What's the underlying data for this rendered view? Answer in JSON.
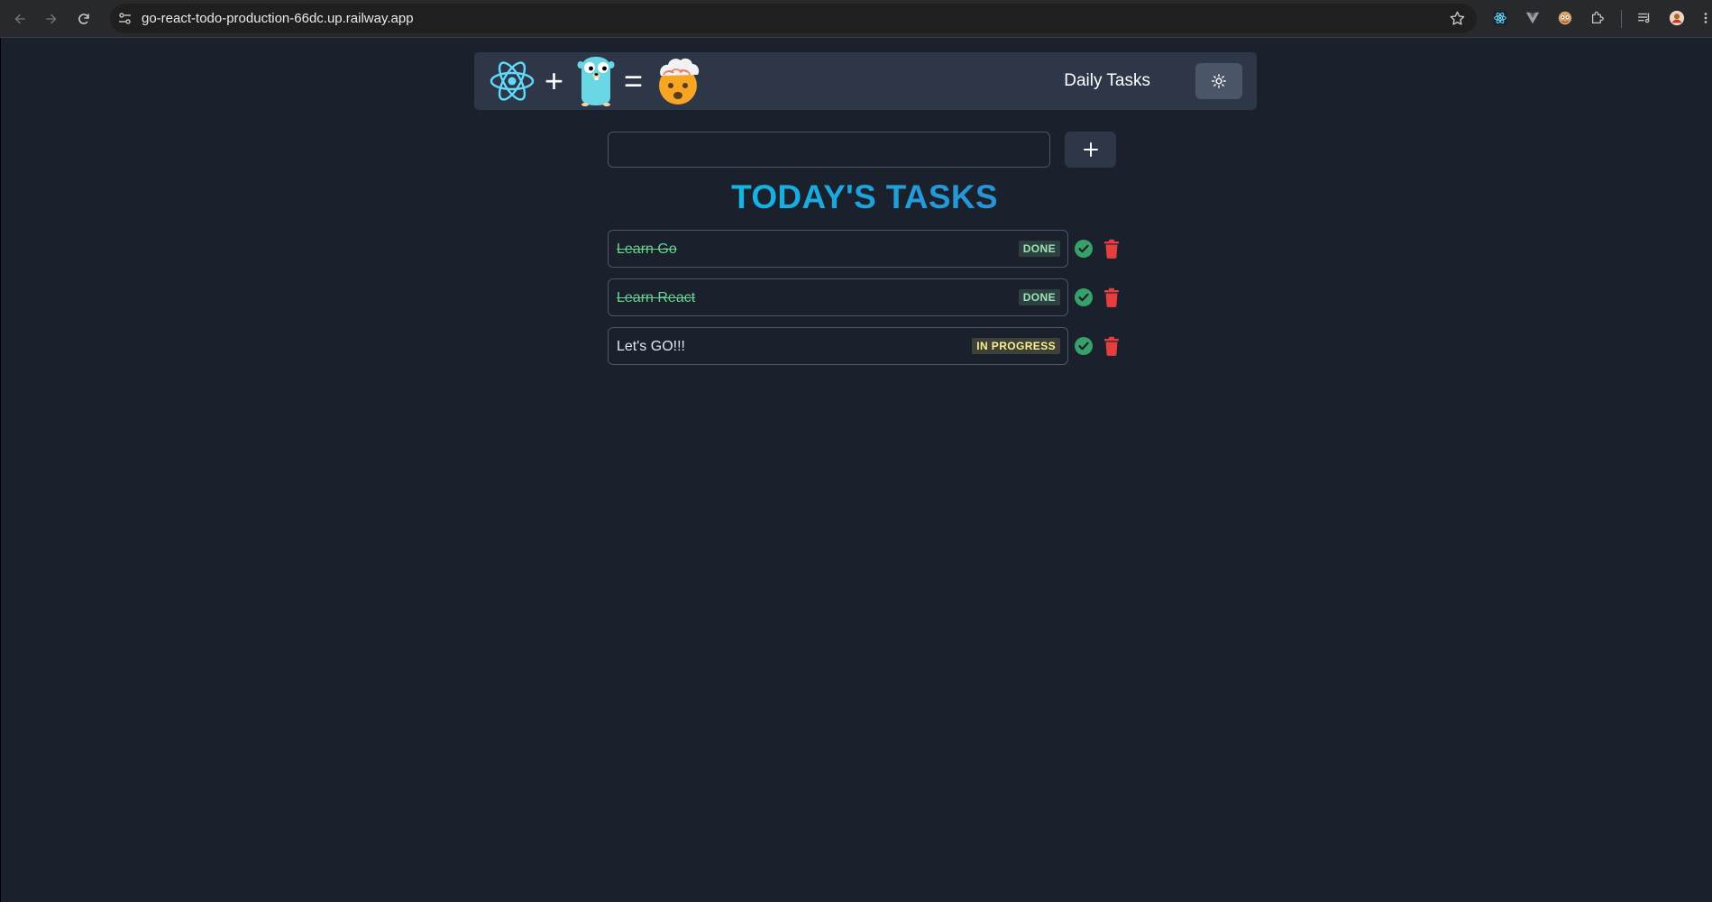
{
  "browser": {
    "url": "go-react-todo-production-66dc.up.railway.app"
  },
  "header": {
    "logo_plus": "+",
    "logo_equals": "=",
    "title": "Daily Tasks",
    "theme_toggle_icon": "sun-icon"
  },
  "form": {
    "input_value": "",
    "add_button_icon": "plus-icon"
  },
  "heading": "TODAY'S TASKS",
  "tasks": [
    {
      "body": "Learn Go",
      "completed": true,
      "status": "DONE"
    },
    {
      "body": "Learn React",
      "completed": true,
      "status": "DONE"
    },
    {
      "body": "Let's GO!!!",
      "completed": false,
      "status": "IN PROGRESS"
    }
  ],
  "colors": {
    "page_bg": "#1a202c",
    "navbar_bg": "#2d3748",
    "heading_gradient_start": "#0bc5ea",
    "heading_gradient_end": "#3182ce",
    "done_text": "#68d391",
    "done_badge_text": "#9ae6b4",
    "progress_badge_text": "#faf089",
    "check_icon": "#38a169",
    "trash_icon": "#e53e3e"
  }
}
